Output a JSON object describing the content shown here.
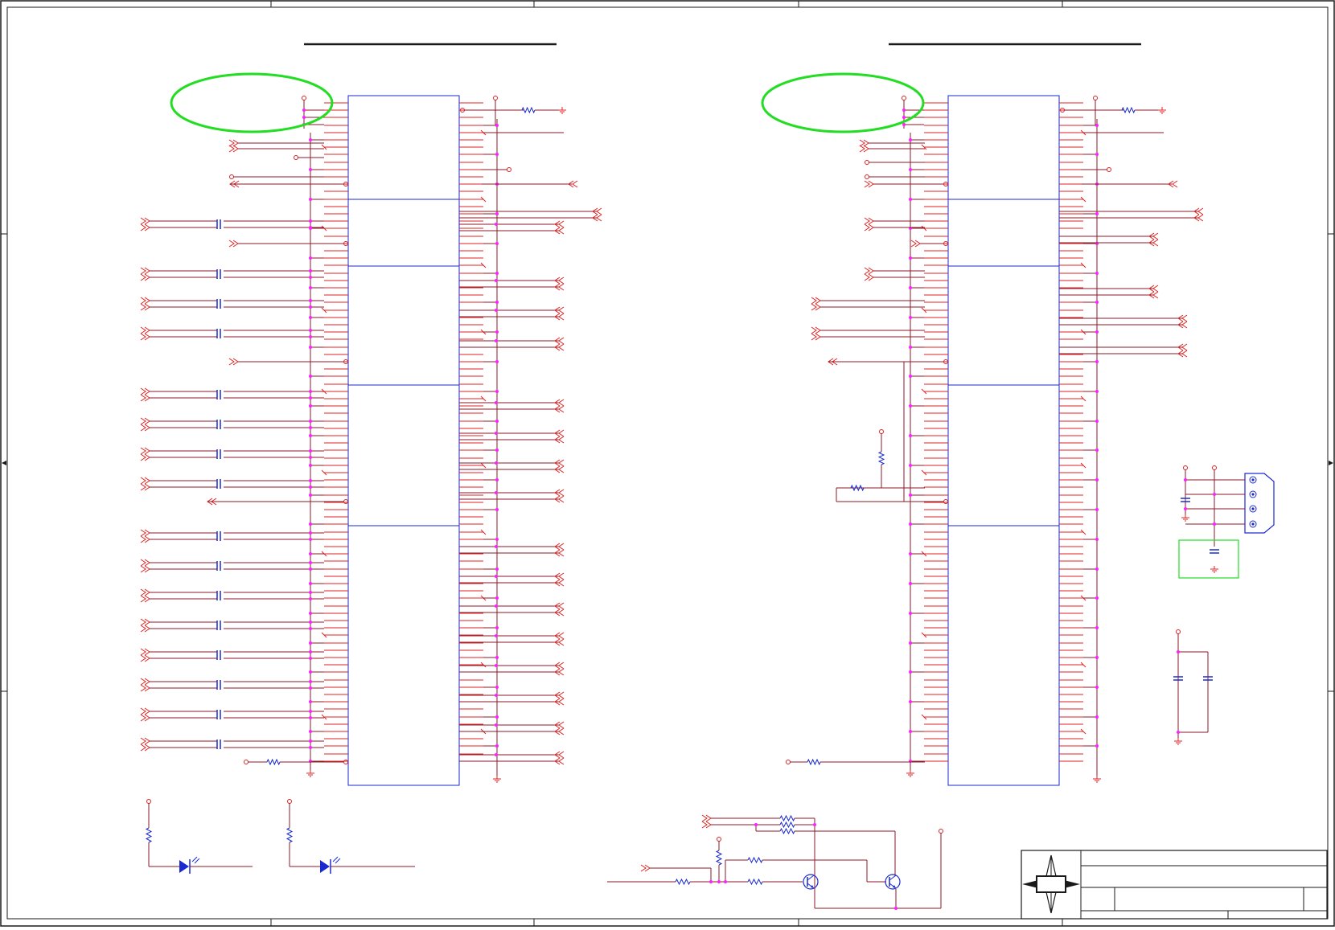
{
  "colors": {
    "frame": "#1a1a1a",
    "wire": "#e02020",
    "net": "#8b1a2a",
    "part": "#1a2ad0",
    "junction": "#ff20ff",
    "highlight": "#22dd22"
  },
  "components": {
    "connectors": [
      {
        "name": "left-slot-connector"
      },
      {
        "name": "right-slot-connector"
      }
    ],
    "devices": [
      "resistor-icon",
      "capacitor-icon",
      "led-icon",
      "npn-transistor-icon",
      "ground-icon",
      "power-pin-icon",
      "off-page-connector-icon",
      "header-jack-icon"
    ]
  },
  "title_block": {
    "logo": "compass-logo-icon",
    "fields": []
  }
}
